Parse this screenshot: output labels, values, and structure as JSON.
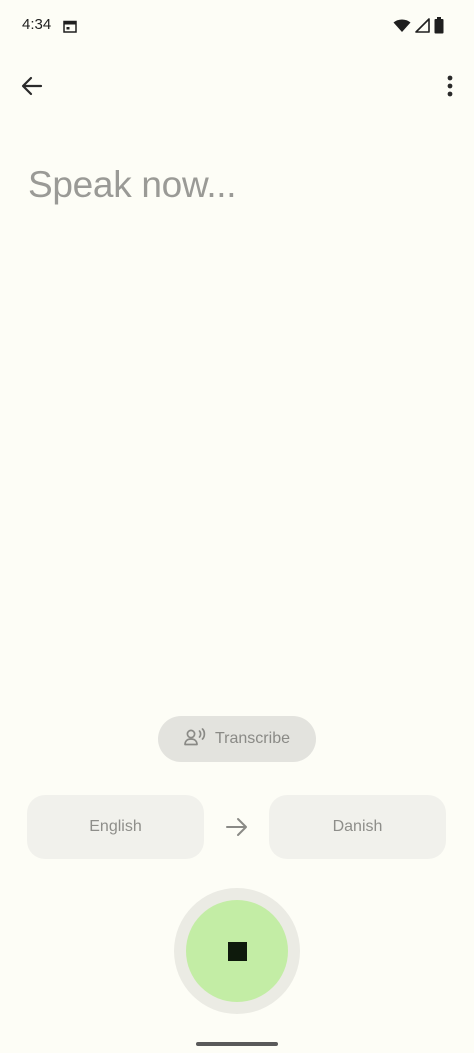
{
  "status_bar": {
    "time": "4:34",
    "icons": [
      "calendar-icon",
      "wifi-icon",
      "signal-icon",
      "battery-icon"
    ]
  },
  "toolbar": {
    "back_icon": "arrow-left-icon",
    "more_icon": "more-vert-icon"
  },
  "main": {
    "prompt": "Speak now..."
  },
  "transcribe": {
    "label": "Transcribe",
    "icon": "voice-person-icon"
  },
  "languages": {
    "source": "English",
    "target": "Danish",
    "swap_icon": "arrow-right-icon"
  },
  "mic": {
    "state_icon": "stop-icon",
    "accent_color": "#c3eda5",
    "ring_color": "#ebebe4"
  },
  "colors": {
    "background": "#fdfdf6",
    "prompt_text": "#9a9a96",
    "chip_background": "#e3e3de",
    "card_background": "#f1f1ec"
  }
}
